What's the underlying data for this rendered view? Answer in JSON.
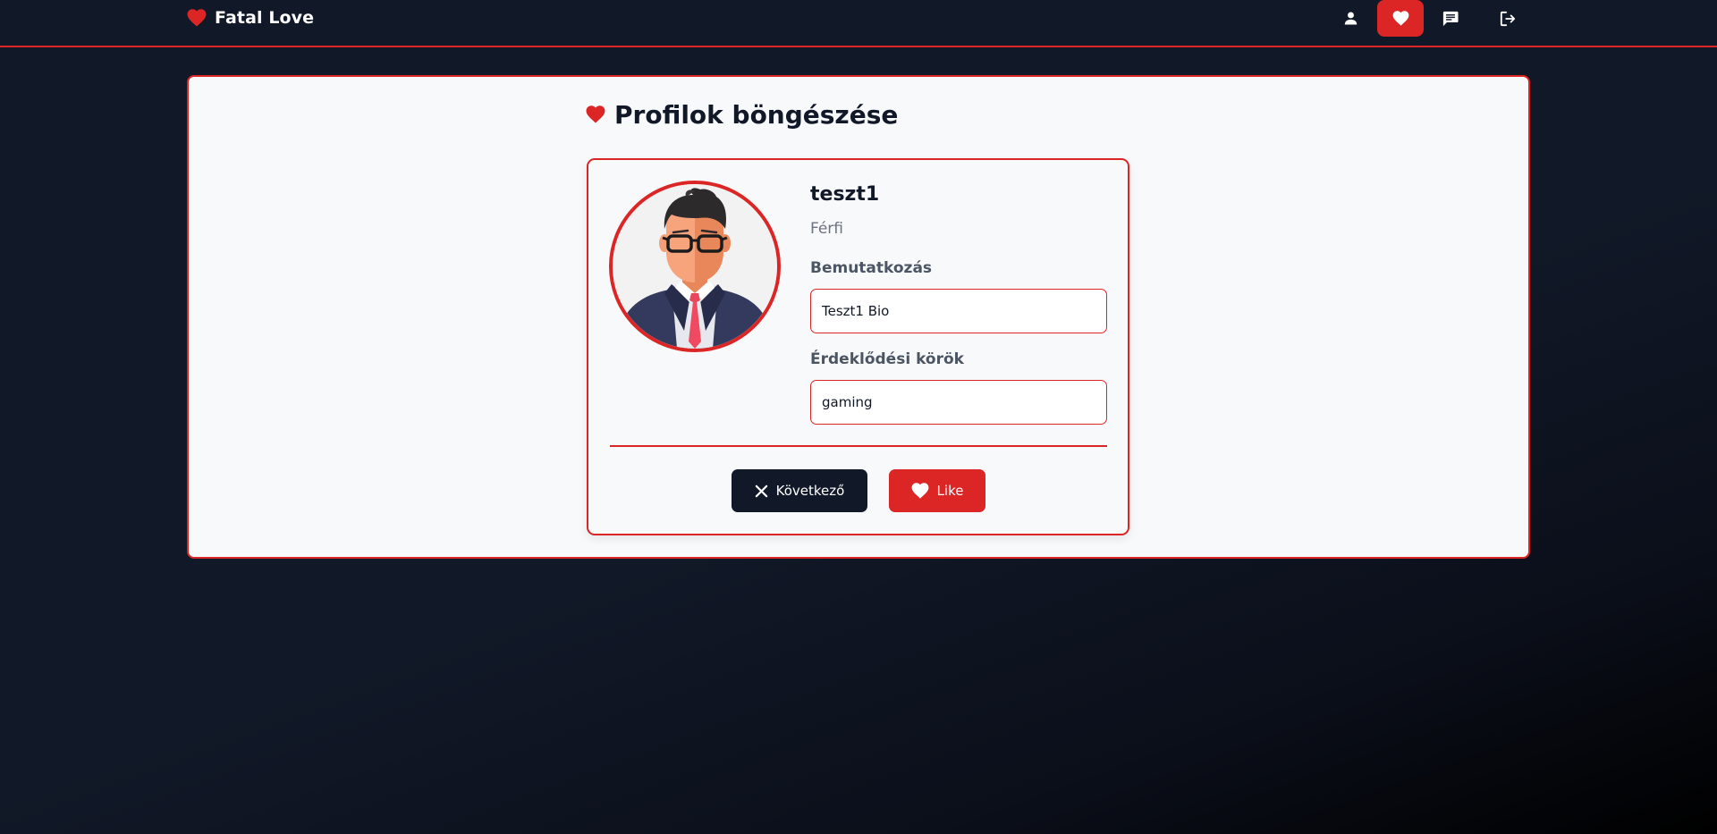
{
  "brand": {
    "name": "Fatal Love",
    "icon": "heart-icon"
  },
  "nav": {
    "items": [
      {
        "icon": "user-icon",
        "active": false
      },
      {
        "icon": "heart-icon",
        "active": true
      },
      {
        "icon": "message-icon",
        "active": false
      },
      {
        "icon": "logout-icon",
        "active": false
      }
    ]
  },
  "page": {
    "title": "Profilok böngészése",
    "title_icon": "heart-icon"
  },
  "profile": {
    "username": "teszt1",
    "gender": "Férfi",
    "avatar": "avatar-man-with-glasses",
    "bio_label": "Bemutatkozás",
    "bio_value": "Teszt1 Bio",
    "interests_label": "Érdeklődési körök",
    "interests_value": "gaming"
  },
  "actions": {
    "next_label": "Következő",
    "next_icon": "close-icon",
    "like_label": "Like",
    "like_icon": "heart-icon"
  },
  "colors": {
    "accent": "#dc2626",
    "background": "#111827",
    "panel": "#f8f9fb",
    "text": "#111827",
    "muted": "#6b7280"
  }
}
